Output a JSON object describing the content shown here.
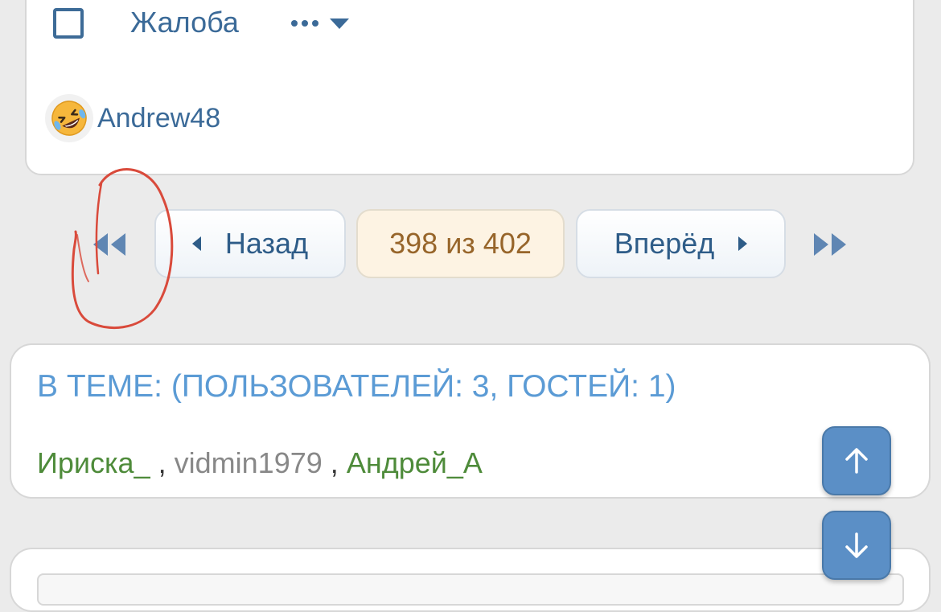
{
  "post": {
    "report_label": "Жалоба",
    "reaction_user": "Andrew48",
    "reaction_emoji": "rolling-on-floor-laughing-emoji"
  },
  "pagination": {
    "prev_label": "Назад",
    "counter_label": "398 из 402",
    "next_label": "Вперёд"
  },
  "topic_users": {
    "title": "В ТЕМЕ: (ПОЛЬЗОВАТЕЛЕЙ: 3, ГОСТЕЙ: 1)",
    "users": [
      "Ириска_",
      "vidmin1979",
      "Андрей_А"
    ],
    "separator": ","
  },
  "colors": {
    "background": "#ebebeb",
    "link": "#3b6a98",
    "counter_text": "#97652a",
    "counter_bg": "#fdf3e3",
    "title": "#5b9bd5",
    "user_green": "#4e8b3a",
    "user_grey": "#888888",
    "scroll_button": "#5b8fc6",
    "annotation": "#d94a3b"
  }
}
